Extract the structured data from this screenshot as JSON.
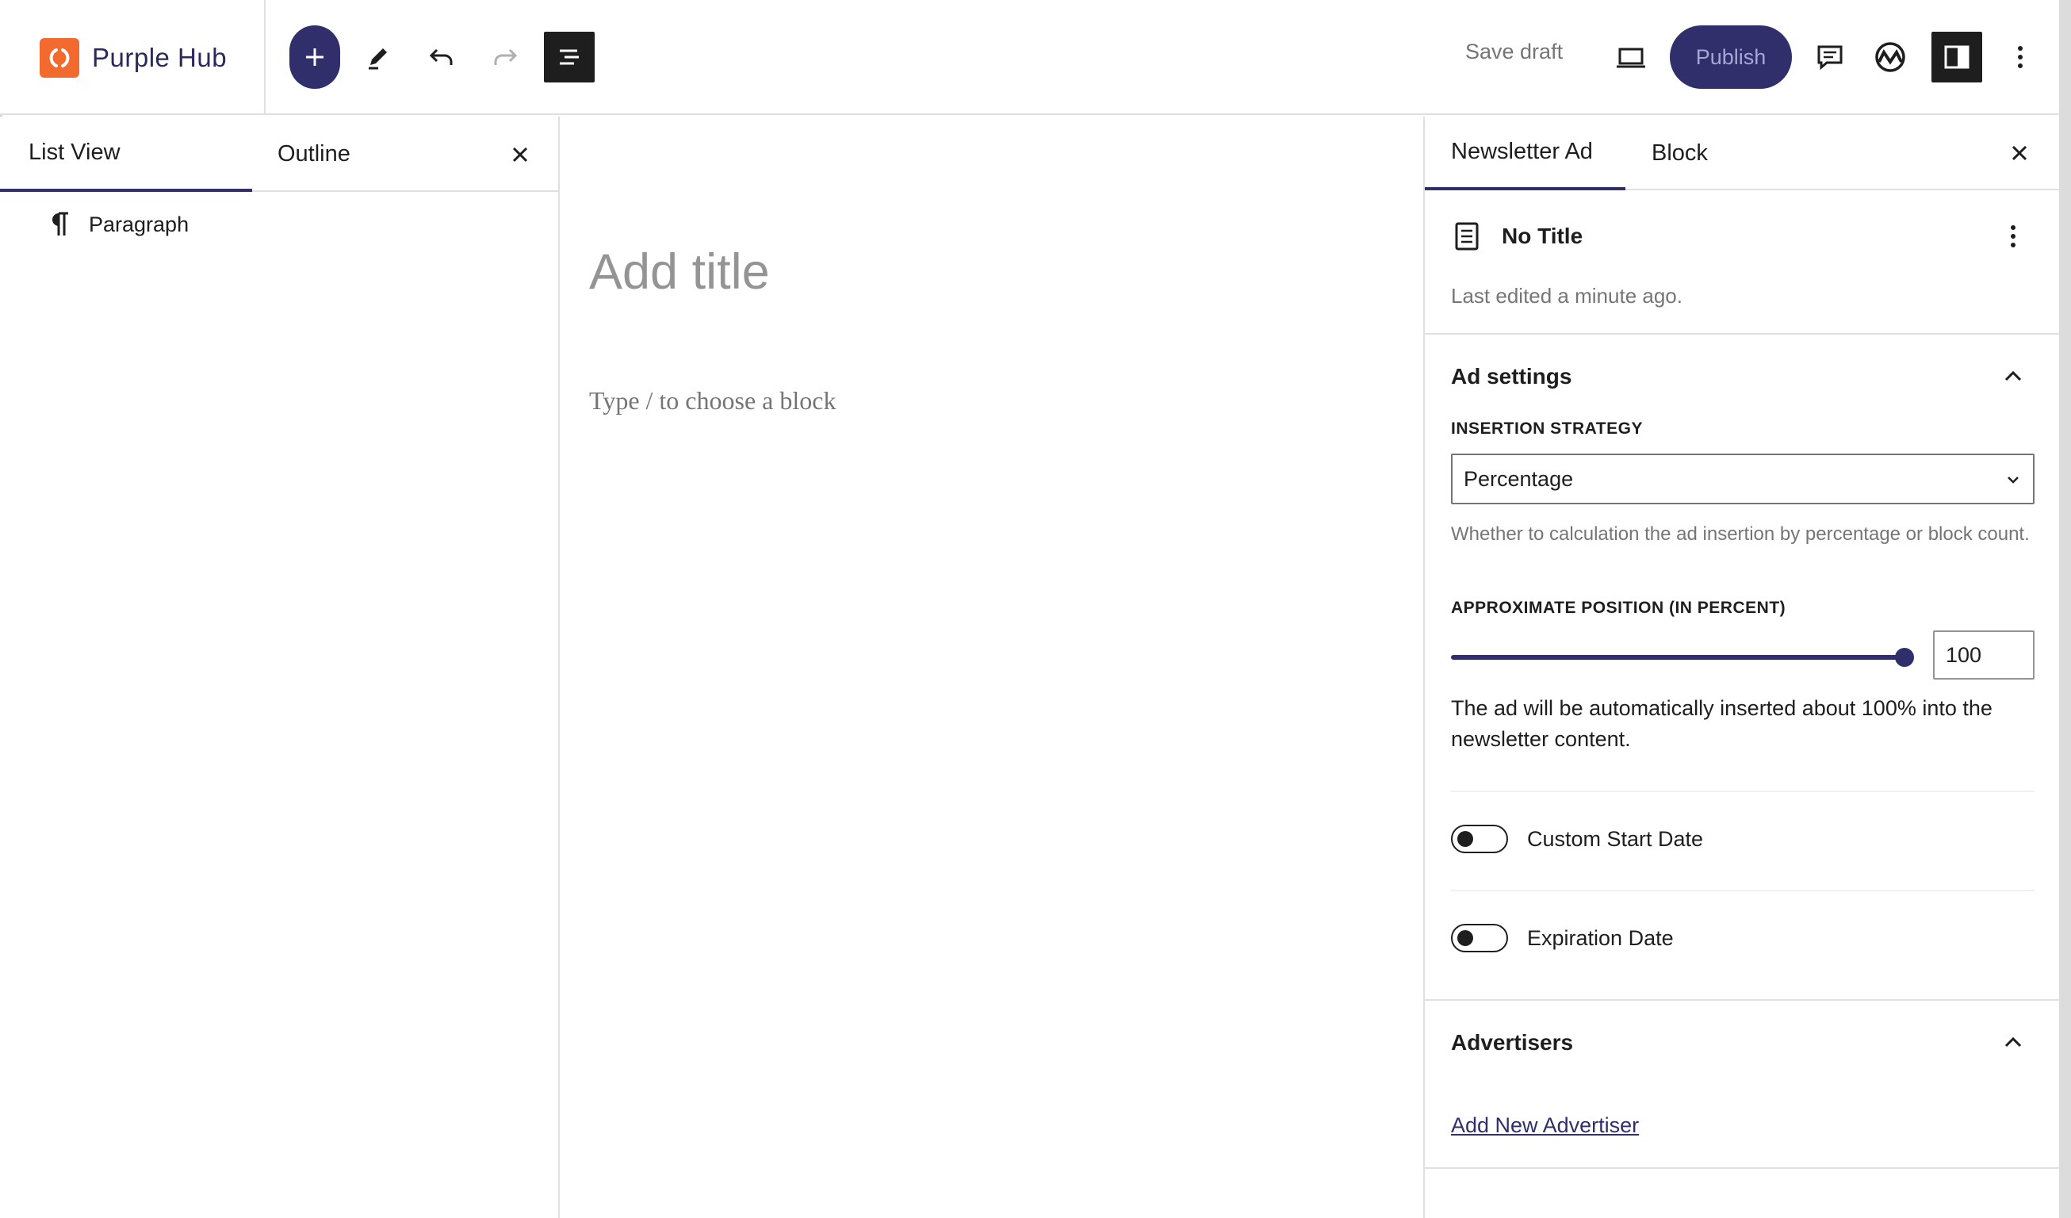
{
  "header": {
    "site_name": "Purple Hub",
    "save_draft_label": "Save draft",
    "publish_label": "Publish"
  },
  "list_view": {
    "tabs": [
      {
        "label": "List View",
        "active": true
      },
      {
        "label": "Outline",
        "active": false
      }
    ],
    "items": [
      {
        "label": "Paragraph",
        "icon": "paragraph-icon"
      }
    ]
  },
  "canvas": {
    "title_placeholder": "Add title",
    "block_placeholder": "Type / to choose a block"
  },
  "sidebar": {
    "tabs": [
      {
        "label": "Newsletter Ad",
        "active": true
      },
      {
        "label": "Block",
        "active": false
      }
    ],
    "document": {
      "title": "No Title",
      "last_edited": "Last edited a minute ago."
    },
    "ad_settings": {
      "heading": "Ad settings",
      "insertion_strategy_label": "Insertion Strategy",
      "insertion_strategy_value": "Percentage",
      "insertion_strategy_help": "Whether to calculation the ad insertion by percentage or block count.",
      "position_label": "Approximate Position (in percent)",
      "position_value": 100,
      "position_input": "100",
      "position_note": "The ad will be automatically inserted about 100% into the newsletter content.",
      "toggles": [
        {
          "label": "Custom Start Date",
          "checked": false
        },
        {
          "label": "Expiration Date",
          "checked": false
        }
      ]
    },
    "advertisers": {
      "heading": "Advertisers",
      "add_link": "Add New Advertiser"
    }
  },
  "colors": {
    "accent": "#302e6b",
    "logo": "#f26a2e"
  }
}
